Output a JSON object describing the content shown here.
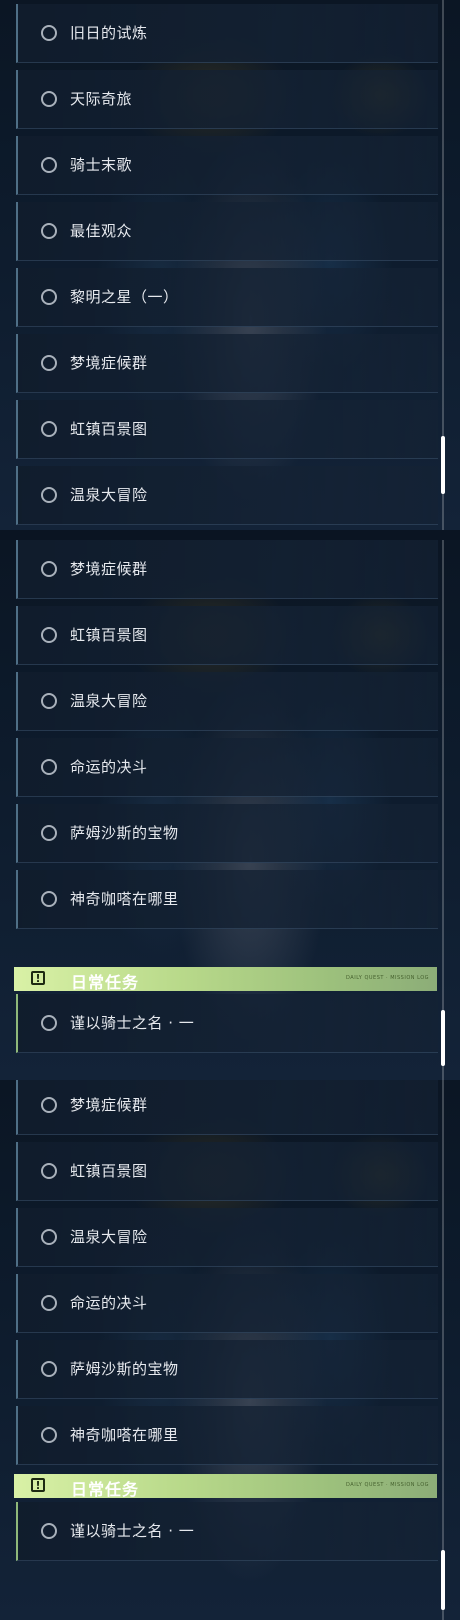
{
  "panels": [
    {
      "quests": [
        {
          "label": "旧日的试炼"
        },
        {
          "label": "天际奇旅"
        },
        {
          "label": "骑士末歌"
        },
        {
          "label": "最佳观众"
        },
        {
          "label": "黎明之星（一）"
        },
        {
          "label": "梦境症候群"
        },
        {
          "label": "虹镇百景图"
        },
        {
          "label": "温泉大冒险"
        }
      ]
    },
    {
      "quests": [
        {
          "label": "梦境症候群"
        },
        {
          "label": "虹镇百景图"
        },
        {
          "label": "温泉大冒险"
        },
        {
          "label": "命运的决斗"
        },
        {
          "label": "萨姆沙斯的宝物"
        },
        {
          "label": "神奇咖嗒在哪里"
        }
      ],
      "category": {
        "icon": "!",
        "label": "日常任务",
        "code": "DAILY QUEST · MISSION LOG"
      },
      "daily_quests": [
        {
          "label": "谨以骑士之名 · 一"
        }
      ]
    },
    {
      "quests": [
        {
          "label": "梦境症候群"
        },
        {
          "label": "虹镇百景图"
        },
        {
          "label": "温泉大冒险"
        },
        {
          "label": "命运的决斗"
        },
        {
          "label": "萨姆沙斯的宝物"
        },
        {
          "label": "神奇咖嗒在哪里"
        }
      ],
      "category": {
        "icon": "!",
        "label": "日常任务",
        "code": "DAILY QUEST · MISSION LOG"
      },
      "daily_quests": [
        {
          "label": "谨以骑士之名 · 一"
        }
      ]
    }
  ],
  "colors": {
    "accent": "#b8d98a",
    "item_border": "#4f6f86",
    "text": "#e6e9ee"
  },
  "icons": {
    "quest": "circle-outline-icon",
    "category": "exclamation-icon"
  }
}
